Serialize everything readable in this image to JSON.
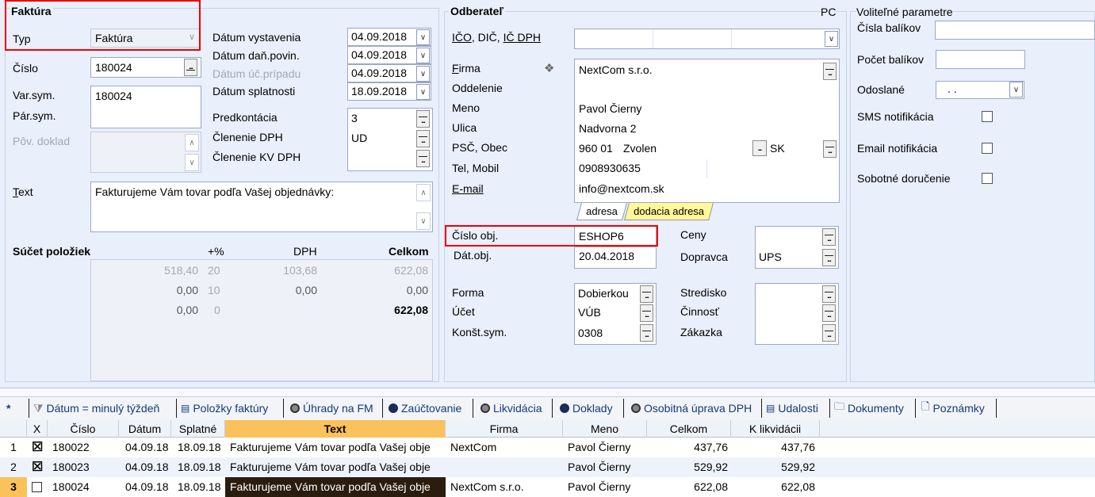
{
  "invoice": {
    "group_title": "Faktúra",
    "typ_label": "Typ",
    "typ_value": "Faktúra",
    "cislo_label": "Číslo",
    "cislo_value": "180024",
    "varsym_label": "Var.sym.",
    "varsym_value": "180024",
    "parsym_label": "Pár.sym.",
    "povdoklad_label": "Pôv. doklad",
    "text_label": "Text",
    "text_value": "Fakturujeme Vám tovar podľa Vašej objednávky:",
    "datum_vystavenia_label": "Dátum vystavenia",
    "datum_vystavenia": "04.09.2018",
    "datum_danpovin_label": "Dátum daň.povin.",
    "datum_danpovin": "04.09.2018",
    "datum_ucprip_label": "Dátum úč.prípadu",
    "datum_ucprip": "04.09.2018",
    "datum_splatnosti_label": "Dátum splatnosti",
    "datum_splatnosti": "18.09.2018",
    "predkontacia_label": "Predkontácia",
    "predkontacia": "3",
    "clenenie_dph_label": "Členenie DPH",
    "clenenie_dph": "UD",
    "clenenie_kv_label": "Členenie KV DPH"
  },
  "totals": {
    "title": "Súčet položiek",
    "col_pct": "+%",
    "col_dph": "DPH",
    "col_celkom": "Celkom",
    "rows": [
      {
        "base": "518,40",
        "pct": "20",
        "dph": "103,68",
        "total": "622,08"
      },
      {
        "base": "0,00",
        "pct": "10",
        "dph": "0,00",
        "total": "0,00"
      },
      {
        "base": "0,00",
        "pct": "0",
        "dph": "",
        "total": "622,08"
      }
    ]
  },
  "customer": {
    "group_title": "Odberateľ",
    "pc": "PC",
    "ico": "IČO",
    "dic": "DIČ",
    "icdph": "IČ DPH",
    "firma_label": "Firma",
    "firma": "NextCom s.r.o.",
    "oddelenie_label": "Oddelenie",
    "meno_label": "Meno",
    "meno": "Pavol Čierny",
    "ulica_label": "Ulica",
    "ulica": "Nadvorna 2",
    "psc_label": "PSČ, Obec",
    "psc": "960 01",
    "obec": "Zvolen",
    "stat": "SK",
    "tel_label": "Tel, Mobil",
    "tel": "0908930635",
    "email_label": "E-mail",
    "email": "info@nextcom.sk",
    "tab_adresa": "adresa",
    "tab_dodacia": "dodacia adresa"
  },
  "order": {
    "cislo_obj_label": "Číslo obj.",
    "cislo_obj": "ESHOP6",
    "dat_obj_label": "Dát.obj.",
    "dat_obj": "20.04.2018",
    "ceny_label": "Ceny",
    "dopravca_label": "Dopravca",
    "dopravca": "UPS",
    "forma_label": "Forma",
    "forma": "Dobierkou",
    "ucet_label": "Účet",
    "ucet": "VÚB",
    "konstsym_label": "Konšt.sym.",
    "konstsym": "0308",
    "stredisko_label": "Stredisko",
    "cinnost_label": "Činnosť",
    "zakazka_label": "Zákazka"
  },
  "optional": {
    "group_title": "Voliteľné parametre",
    "cisla_balikov": "Čísla balíkov",
    "pocet_balikov": "Počet balíkov",
    "odoslane": "Odoslané",
    "odoslane_value": ". .",
    "sms": "SMS notifikácia",
    "email": "Email notifikácia",
    "sobotne": "Sobotné doručenie"
  },
  "toolbar": {
    "star": "*",
    "filter": "Dátum = minulý týždeň",
    "polozky": "Položky faktúry",
    "uhrady": "Úhrady na FM",
    "zauctovanie": "Zaúčtovanie",
    "likvidacia": "Likvidácia",
    "doklady": "Doklady",
    "osobitna": "Osobitná úprava DPH",
    "udalosti": "Udalosti",
    "dokumenty": "Dokumenty",
    "poznamky": "Poznámky"
  },
  "grid": {
    "headers": {
      "x": "X",
      "cislo": "Číslo",
      "datum": "Dátum",
      "splatne": "Splatné",
      "text": "Text",
      "firma": "Firma",
      "meno": "Meno",
      "celkom": "Celkom",
      "klikvidacii": "K likvidácii"
    },
    "rows": [
      {
        "n": "1",
        "checked": "☒",
        "cislo": "180022",
        "datum": "04.09.18",
        "splatne": "18.09.18",
        "text": "Fakturujeme Vám tovar podľa Vašej obje",
        "firma": "NextCom",
        "meno": "Pavol Čierny",
        "celkom": "437,76",
        "klikv": "437,76"
      },
      {
        "n": "2",
        "checked": "☒",
        "cislo": "180023",
        "datum": "04.09.18",
        "splatne": "18.09.18",
        "text": "Fakturujeme Vám tovar podľa Vašej obje",
        "firma": "",
        "meno": "Pavol Čierny",
        "celkom": "529,92",
        "klikv": "529,92"
      },
      {
        "n": "3",
        "checked": "",
        "cislo": "180024",
        "datum": "04.09.18",
        "splatne": "18.09.18",
        "text": "Fakturujeme Vám tovar podľa Vašej obje",
        "firma": "NextCom s.r.o.",
        "meno": "Pavol Čierny",
        "celkom": "622,08",
        "klikv": "622,08"
      }
    ]
  },
  "colors": {
    "highlight": "#fbc15b",
    "selected_row": "#2b1d0e",
    "red_box": "#e00000"
  }
}
